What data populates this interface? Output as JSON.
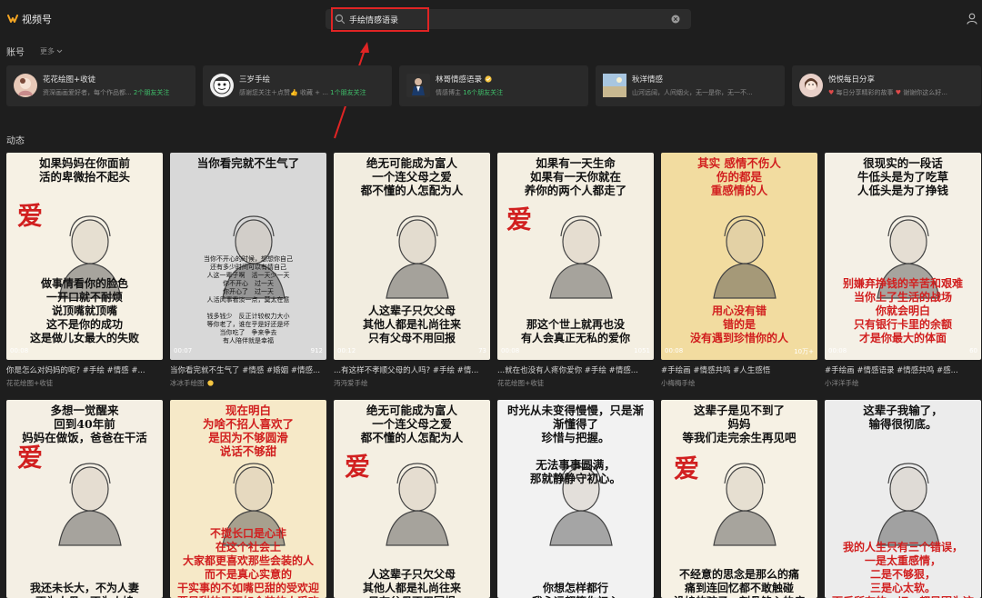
{
  "header": {
    "app_name": "视频号",
    "search_value": "手绘情感语录",
    "brand_color": "#f5a623"
  },
  "accounts_section": {
    "label": "账号",
    "more_label": "更多",
    "items": [
      {
        "name": "花花绘图+收徒",
        "desc": "资深画画爱好者，每个作品都...",
        "friends": "2个朋友关注",
        "verified": false,
        "avatar_color": "#e8c9b8"
      },
      {
        "name": "三岁手绘",
        "desc": "感谢您关注＋点赞👍 收藏 + ...",
        "friends": "1个朋友关注",
        "verified": false,
        "avatar_color": "#f0f0f0"
      },
      {
        "name": "林哥情感语录",
        "desc": "情感博主",
        "friends": "16个朋友关注",
        "verified": true,
        "avatar_color": "#3a3a3a"
      },
      {
        "name": "秋洋情感",
        "desc": "山河远阔，人间烟火，无一是你，无一不...",
        "friends": "",
        "verified": false,
        "avatar_color": "#7a9cb8"
      },
      {
        "name": "悦悦每日分享",
        "desc": "每日分享精彩的故事",
        "desc2": "谢谢你这么好...",
        "friends": "",
        "verified": false,
        "avatar_color": "#e8d0c8"
      }
    ]
  },
  "feed_section": {
    "label": "动态",
    "videos": [
      {
        "top_text": "如果妈妈在你面前\n活的卑微抬不起头",
        "bottom_text": "做事情看你的脸色\n一开口就不耐烦\n说顶嘴就顶嘴\n这不是你的成功\n这是做儿女最大的失败",
        "duration": "00:08",
        "likes": "",
        "title": "你是怎么对妈妈的呢? #手绘 #情感 #...",
        "author": "花花绘图+收徒",
        "bg": "#f6f1e4"
      },
      {
        "top_text": "当你看完就不生气了",
        "bottom_text": "当你不开心的时候，想想你自己\n还有多少时间可以有情自己\n人这一辈子啊　活一天少一天\n你不开心　过一天\n你开心了　过一天\n人活风事看淡一点，莫太在意\n\n钱多钱少　反正计较权力大小\n等你老了，谁在乎是好还是坏\n当你吃了　争来争去\n有人陪伴就是幸福",
        "duration": "00:07",
        "likes": "912",
        "title": "当你看完就不生气了 #情感 #婚姻 #情感...",
        "author": "冰冰手绘图",
        "author_verified": true,
        "bg": "#d8d8d8"
      },
      {
        "top_text": "绝无可能成为富人\n一个连父母之爱\n都不懂的人怎配为人",
        "bottom_text": "人这辈子只欠父母\n其他人都是礼尚往来\n只有父母不用回报",
        "duration": "00:12",
        "likes": "73",
        "title": "...有这样不孝顺父母的人吗? #手绘 #情...",
        "author": "沔沔爱手绘",
        "bg": "#f2ede0"
      },
      {
        "top_text": "如果有一天生命\n如果有一天你就在\n养你的两个人都走了",
        "bottom_text": "那这个世上就再也没\n有人会真正无私的爱你",
        "duration": "00:08",
        "likes": "1051",
        "title": "...就在也没有人疼你爱你 #手绘 #情感...",
        "author": "花花绘图+收徒",
        "bg": "#f4efe2"
      },
      {
        "top_text": "其实 感情不伤人\n伤的都是\n重感情的人",
        "bottom_text": "用心没有错\n错的是\n没有遇到珍惜你的人",
        "duration": "00:08",
        "likes": "10万+",
        "title": "#手绘画 #情感共鸣 #人生感悟",
        "author": "小梅梅手绘",
        "bg": "#f2dca0"
      },
      {
        "top_text": "很现实的一段话\n牛低头是为了吃草\n人低头是为了挣钱",
        "bottom_text": "别嫌弃挣钱的辛苦和艰难\n当你上了生活的战场\n你就会明白\n只有银行卡里的余额\n才是你最大的体面",
        "duration": "00:08",
        "likes": "60",
        "title": "#手绘画 #情感语录 #情感共鸣 #感...",
        "author": "小洋洋手绘",
        "bg": "#f4f0e6"
      },
      {
        "top_text": "多想一觉醒来\n回到40年前\n妈妈在做饭，爸爸在干活",
        "bottom_text": "我还未长大，不为人妻\n不为人母，不为人媳",
        "duration": "",
        "likes": "",
        "title": "",
        "author": "",
        "bg": "#f4efe4"
      },
      {
        "top_text": "现在明白\n为啥不招人喜欢了\n是因为不够圆滑\n说话不够甜",
        "bottom_text": "不搅长口是心非\n在这个社会上\n大家都更喜欢那些会装的人\n而不是真心实意的\n干实事的不如嘴巴甜的受欢迎\n要是甜的又不如会装的人受欢迎",
        "duration": "",
        "likes": "",
        "title": "",
        "author": "",
        "bg": "#f6e9c8"
      },
      {
        "top_text": "绝无可能成为富人\n一个连父母之爱\n都不懂的人怎配为人",
        "bottom_text": "人这辈子只欠父母\n其他人都是礼尚往来\n只有父母不用回报",
        "duration": "",
        "likes": "",
        "title": "",
        "author": "",
        "bg": "#f4efe2"
      },
      {
        "top_text": "时光从未变得慢慢，只是渐渐懂得了\n珍惜与把握。\n\n无法事事圆满，\n那就静静守初心。",
        "bottom_text": "你想怎样都行\n我永远都等你初心",
        "duration": "",
        "likes": "",
        "title": "",
        "author": "",
        "bg": "#f2f2f2"
      },
      {
        "top_text": "这辈子是见不到了\n妈妈\n等我们走完余生再见吧",
        "bottom_text": "不经意的思念是那么的痛\n痛到连回忆都不敢触碰\n没娘的孩子，刻骨铭心的疼",
        "duration": "",
        "likes": "",
        "title": "",
        "author": "",
        "bg": "#f6f1e4"
      },
      {
        "top_text": "这辈子我输了，\n输得很彻底。",
        "bottom_text": "我的人生只有三个错误，\n一是太重感情，\n二是不够狠，\n三是心太软。\n而后所有的一切，都是因为这些",
        "duration": "",
        "likes": "",
        "title": "",
        "author": "",
        "bg": "#ececec"
      }
    ]
  }
}
